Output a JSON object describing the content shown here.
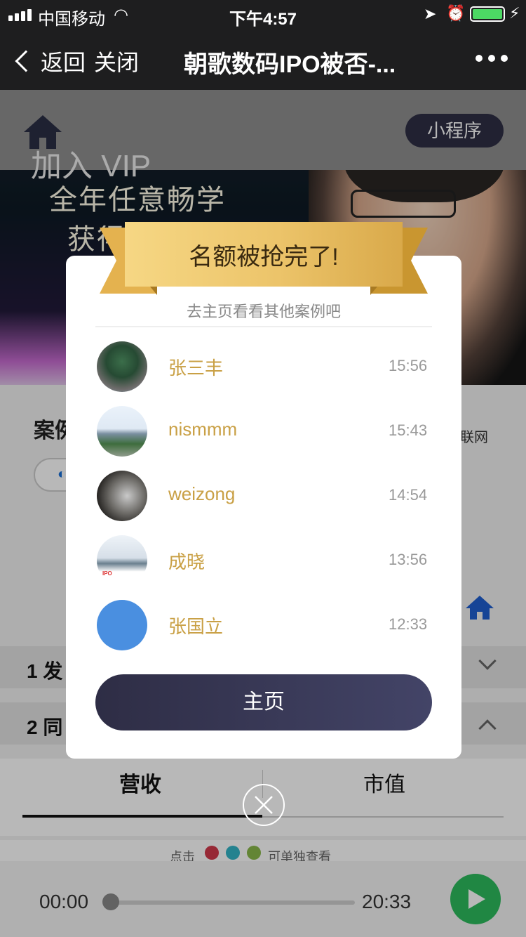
{
  "status_bar": {
    "carrier": "中国移动",
    "time": "下午4:57",
    "wifi_icon": "wifi-icon",
    "battery_level": 1.0
  },
  "nav": {
    "back_label": "返回",
    "close_label": "关闭",
    "title": "朝歌数码IPO被否-..."
  },
  "banner": {
    "vip_text": "加入 VIP",
    "line1": "全年任意畅学",
    "line2": "获得更多海内干货",
    "mini_program_label": "小程序"
  },
  "page": {
    "section_title": "案例",
    "section_right": "联网",
    "pill_label": "◐",
    "accordion": [
      {
        "label": "1 发"
      },
      {
        "label": "2 同"
      }
    ],
    "tabs": [
      {
        "label": "营收"
      },
      {
        "label": "市值"
      }
    ],
    "legend": {
      "pre": "点击",
      "post": "可单独查看",
      "colors": [
        "#d23a4c",
        "#33b4c6",
        "#8ab94a"
      ]
    }
  },
  "player": {
    "current": "00:00",
    "total": "20:33",
    "progress": 0.0
  },
  "modal": {
    "ribbon_title": "名额被抢完了!",
    "subtitle": "去主页看看其他案例吧",
    "rows": [
      {
        "name": "张三丰",
        "time": "15:56"
      },
      {
        "name": "nismmm",
        "time": "15:43"
      },
      {
        "name": "weizong",
        "time": "14:54"
      },
      {
        "name": "成晓",
        "time": "13:56",
        "avatar_tag": "IPO"
      },
      {
        "name": "张国立",
        "time": "12:33"
      }
    ],
    "home_button": "主页"
  },
  "colors": {
    "accent_gold": "#c9a045",
    "button_dark": "#2e2d45",
    "play_green": "#2dbb5d"
  }
}
